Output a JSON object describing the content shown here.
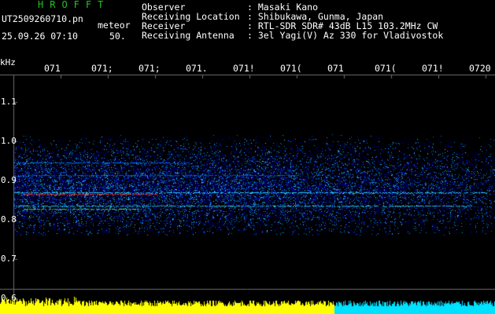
{
  "app": {
    "title": "HROFFT"
  },
  "file": {
    "name": "UT2509260710.pn",
    "mode": "meteor",
    "datetime": "25.09.26 07:10",
    "speed": "50."
  },
  "info": [
    {
      "key": "Observer",
      "value": ": Masaki Kano"
    },
    {
      "key": "Receiving Location",
      "value": ": Shibukawa, Gunma, Japan"
    },
    {
      "key": "Receiver",
      "value": ": RTL-SDR SDR# 43dB L15 103.2MHz CW"
    },
    {
      "key": "Receiving Antenna",
      "value": ": 3el Yagi(V) Az 330 for Vladivostok"
    }
  ],
  "axis": {
    "y_unit": "kHz",
    "y_ticks": [
      "1.1",
      "1.0",
      "0.9",
      "0.8",
      "0.7",
      "0.6"
    ],
    "x_ticks": [
      "071",
      "071;",
      "071;",
      "071.",
      "071!",
      "071(",
      "071",
      "071(",
      "071!",
      "0720"
    ]
  },
  "colors": {
    "background": "#000000",
    "title_green": "#21c421",
    "grid": "#6e6e6e",
    "signal_yellow": "#ffff00",
    "signal_cyan": "#00e0ff"
  }
}
